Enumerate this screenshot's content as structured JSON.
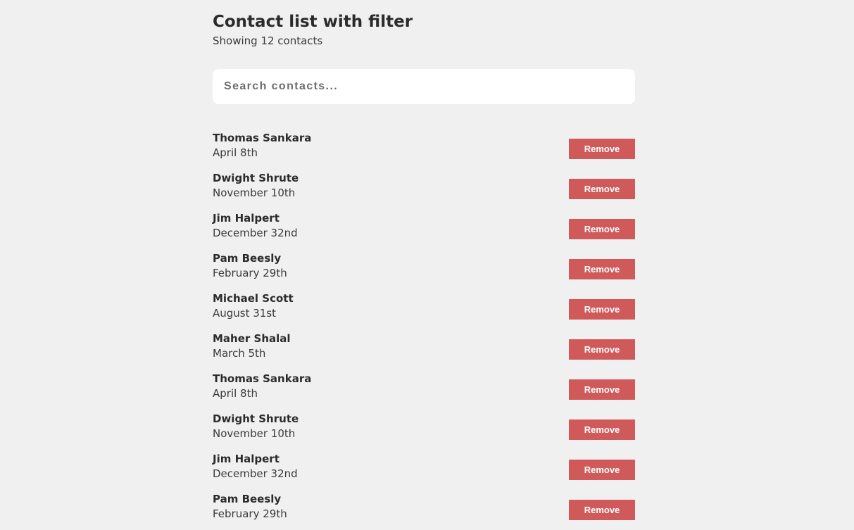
{
  "header": {
    "title": "Contact list with filter",
    "subtitle": "Showing 12 contacts"
  },
  "search": {
    "placeholder": "Search contacts...",
    "value": ""
  },
  "contacts": [
    {
      "name": "Thomas Sankara",
      "date": "April 8th",
      "action": "Remove"
    },
    {
      "name": "Dwight Shrute",
      "date": "November 10th",
      "action": "Remove"
    },
    {
      "name": "Jim Halpert",
      "date": "December 32nd",
      "action": "Remove"
    },
    {
      "name": "Pam Beesly",
      "date": "February 29th",
      "action": "Remove"
    },
    {
      "name": "Michael Scott",
      "date": "August 31st",
      "action": "Remove"
    },
    {
      "name": "Maher Shalal",
      "date": "March 5th",
      "action": "Remove"
    },
    {
      "name": "Thomas Sankara",
      "date": "April 8th",
      "action": "Remove"
    },
    {
      "name": "Dwight Shrute",
      "date": "November 10th",
      "action": "Remove"
    },
    {
      "name": "Jim Halpert",
      "date": "December 32nd",
      "action": "Remove"
    },
    {
      "name": "Pam Beesly",
      "date": "February 29th",
      "action": "Remove"
    }
  ],
  "colors": {
    "background": "#f0f0f0",
    "remove_button": "#d05a5a",
    "text": "#2b2b2b"
  }
}
